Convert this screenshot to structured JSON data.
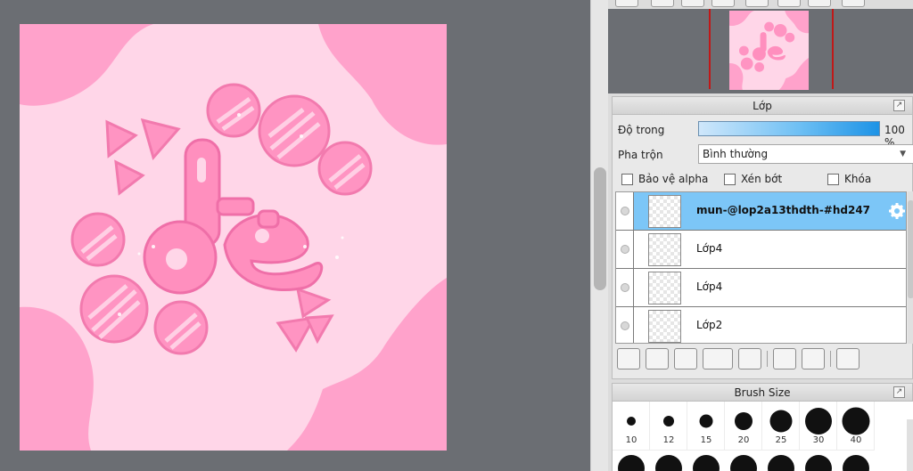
{
  "canvas": {
    "artwork_text": "lễ",
    "colors": {
      "background": "#ffd6e8",
      "blob": "#ffa2cb",
      "letters": "#ff8fbe",
      "letters_dark": "#ef6fa8"
    }
  },
  "layer_panel": {
    "title": "Lớp",
    "opacity_label": "Độ trong",
    "opacity_value": "100 %",
    "opacity_percent": 100,
    "blend_label": "Pha trộn",
    "blend_value": "Bình thường",
    "checkboxes": [
      {
        "label": "Bảo vệ alpha",
        "checked": false
      },
      {
        "label": "Xén bớt",
        "checked": false
      },
      {
        "label": "Khóa",
        "checked": false
      }
    ],
    "layers": [
      {
        "name": "mun-@lop2a13thdth-#hd247",
        "selected": true
      },
      {
        "name": "Lớp4",
        "selected": false
      },
      {
        "name": "Lớp4",
        "selected": false
      },
      {
        "name": "Lớp2",
        "selected": false
      }
    ],
    "toolbar_icons": [
      "new-layer-icon",
      "new-8bit-layer-icon",
      "new-1bit-layer-icon",
      "add-layer-menu-icon",
      "folder-icon",
      "duplicate-layer-icon",
      "merge-down-icon",
      "delete-layer-icon"
    ]
  },
  "brush_panel": {
    "title": "Brush Size",
    "sizes": [
      "10",
      "12",
      "15",
      "20",
      "25",
      "30",
      "40"
    ]
  },
  "accent": "#7cc6f7"
}
